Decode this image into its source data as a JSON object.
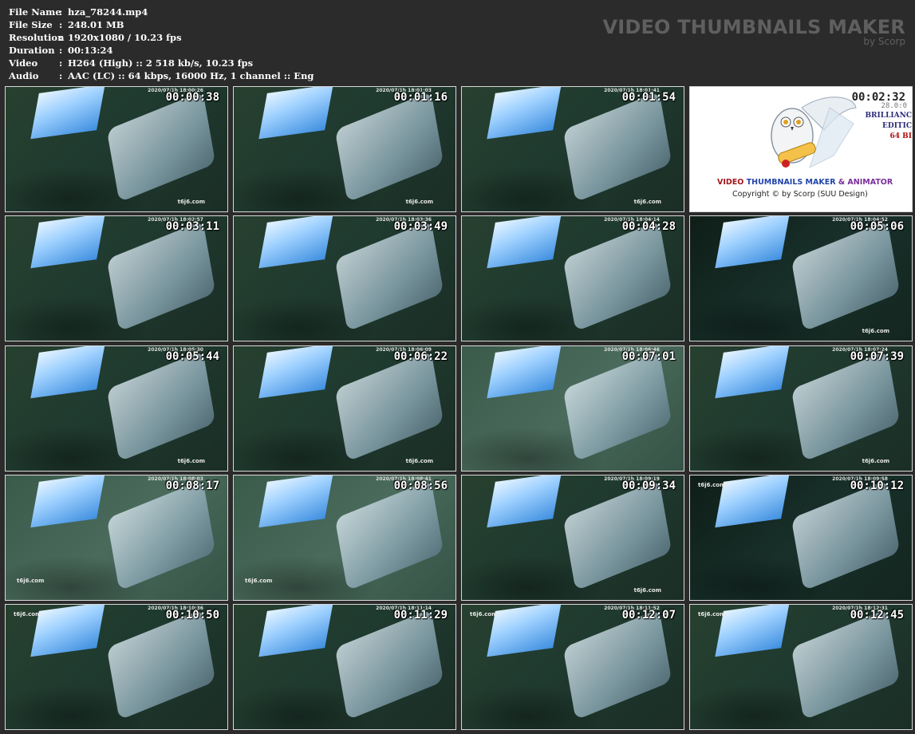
{
  "info": [
    {
      "label": "File Name",
      "sep": ":",
      "value": "hza_78244.mp4"
    },
    {
      "label": "File Size",
      "sep": ":",
      "value": "248.01 MB"
    },
    {
      "label": "Resolution",
      "sep": ":",
      "value": "1920x1080 / 10.23 fps"
    },
    {
      "label": "Duration",
      "sep": ":",
      "value": "00:13:24"
    },
    {
      "label": "Video",
      "sep": ":",
      "value": "H264 (High) :: 2 518 kb/s, 10.23 fps"
    },
    {
      "label": "Audio",
      "sep": ":",
      "value": "AAC (LC) :: 64 kbps, 16000 Hz, 1 channel :: Eng"
    }
  ],
  "brand": {
    "title": "VIDEO THUMBNAILS MAKER",
    "subtitle": "by Scorp"
  },
  "logo": {
    "part1": "VIDEO ",
    "part2": "THUMBNAILS MAKER ",
    "part3": "& ANIMATOR",
    "copyright": "Copyright © by Scorp (SUU Design)",
    "edition1": "BRILLIANC",
    "edition2": "EDITIC",
    "edition3": "64 BI",
    "timecode": "00:02:32",
    "timecode_ghost": "28.0:0"
  },
  "thumbs": [
    {
      "time": "00:00:38",
      "stamp": "2020/07/1h 18:00:26",
      "wm": "t6j6.com",
      "wmpos": "br",
      "tone": ""
    },
    {
      "time": "00:01:16",
      "stamp": "2020/07/1h 18:01:03",
      "wm": "t6j6.com",
      "wmpos": "br",
      "tone": ""
    },
    {
      "time": "00:01:54",
      "stamp": "2020/07/1h 18:01:41",
      "wm": "t6j6.com",
      "wmpos": "br",
      "tone": ""
    },
    {
      "time": "00:03:11",
      "stamp": "2020/07/1h 18:02:57",
      "wm": "",
      "wmpos": "br",
      "tone": ""
    },
    {
      "time": "00:03:49",
      "stamp": "2020/07/1h 18:03:36",
      "wm": "",
      "wmpos": "br",
      "tone": ""
    },
    {
      "time": "00:04:28",
      "stamp": "2020/07/1h 18:04:14",
      "wm": "",
      "wmpos": "br",
      "tone": ""
    },
    {
      "time": "00:05:06",
      "stamp": "2020/07/1h 18:04:52",
      "wm": "t6j6.com",
      "wmpos": "br",
      "tone": "dark"
    },
    {
      "time": "00:05:44",
      "stamp": "2020/07/1h 18:05:30",
      "wm": "t6j6.com",
      "wmpos": "br",
      "tone": ""
    },
    {
      "time": "00:06:22",
      "stamp": "2020/07/1h 18:06:09",
      "wm": "t6j6.com",
      "wmpos": "br",
      "tone": ""
    },
    {
      "time": "00:07:01",
      "stamp": "2020/07/1h 18:06:46",
      "wm": "",
      "wmpos": "br",
      "tone": "light"
    },
    {
      "time": "00:07:39",
      "stamp": "2020/07/1h 18:07:24",
      "wm": "t6j6.com",
      "wmpos": "br",
      "tone": ""
    },
    {
      "time": "00:08:17",
      "stamp": "2020/07/1h 18:08:03",
      "wm": "t6j6.com",
      "wmpos": "bl",
      "tone": "light"
    },
    {
      "time": "00:08:56",
      "stamp": "2020/07/1h 18:08:41",
      "wm": "t6j6.com",
      "wmpos": "bl",
      "tone": "light"
    },
    {
      "time": "00:09:34",
      "stamp": "2020/07/1h 18:09:19",
      "wm": "t6j6.com",
      "wmpos": "br",
      "tone": ""
    },
    {
      "time": "00:10:12",
      "stamp": "2020/07/1h 18:09:58",
      "wm": "t6j6.com",
      "wmpos": "tl",
      "tone": "dark"
    },
    {
      "time": "00:10:50",
      "stamp": "2020/07/1h 18:10:36",
      "wm": "t6j6.com",
      "wmpos": "tl",
      "tone": ""
    },
    {
      "time": "00:11:29",
      "stamp": "2020/07/1h 18:11:14",
      "wm": "",
      "wmpos": "tl",
      "tone": ""
    },
    {
      "time": "00:12:07",
      "stamp": "2020/07/1h 18:11:52",
      "wm": "t6j6.com",
      "wmpos": "tl",
      "tone": ""
    },
    {
      "time": "00:12:45",
      "stamp": "2020/07/1h 18:12:31",
      "wm": "t6j6.com",
      "wmpos": "tl",
      "tone": ""
    }
  ],
  "colors": {
    "background": "#2b2b2b",
    "brand": "#5f5f5f"
  }
}
